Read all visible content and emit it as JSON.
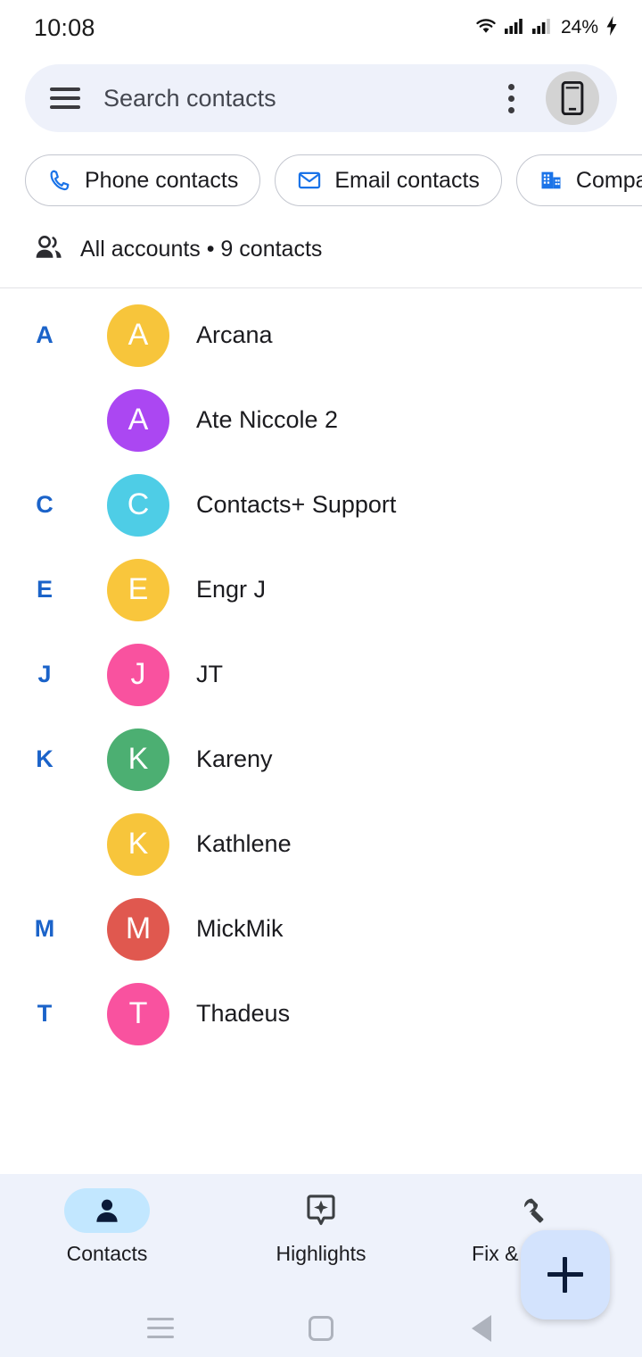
{
  "status_bar": {
    "time": "10:08",
    "battery_percent": "24%",
    "icons": [
      "wifi-icon",
      "signal-1-icon",
      "signal-2-icon",
      "charging-bolt-icon"
    ]
  },
  "search": {
    "menu_icon": "hamburger-menu-icon",
    "placeholder": "Search contacts",
    "value": "",
    "overflow_icon": "kebab-menu-icon",
    "account_icon": "device-phone-icon"
  },
  "filter_chips": [
    {
      "label": "Phone contacts",
      "icon": "phone-icon",
      "has_caret": false
    },
    {
      "label": "Email contacts",
      "icon": "envelope-icon",
      "has_caret": false
    },
    {
      "label": "Company",
      "icon": "building-icon",
      "has_caret": true
    }
  ],
  "account_summary": {
    "icon": "people-group-icon",
    "text": "All accounts • 9 contacts"
  },
  "contacts": [
    {
      "section": "A",
      "name": "Arcana",
      "initial": "A",
      "color": "#f9c game"
    },
    {
      "section": "",
      "name": "Ate Niccole 2",
      "initial": "A",
      "color": "#ab47f2"
    },
    {
      "section": "C",
      "name": "Contacts+ Support",
      "initial": "C",
      "color": "#4ecde6"
    },
    {
      "section": "E",
      "name": "Engr J",
      "initial": "E",
      "color": "#f9c63c"
    },
    {
      "section": "J",
      "name": "JT",
      "initial": "J",
      "color": "#f9529f"
    },
    {
      "section": "K",
      "name": "Kareny",
      "initial": "K",
      "color": "#4caf72"
    },
    {
      "section": "",
      "name": "Kathlene",
      "initial": "K",
      "color": "#f7c53b"
    },
    {
      "section": "M",
      "name": "MickMik",
      "initial": "M",
      "color": "#e0584f"
    },
    {
      "section": "T",
      "name": "Thadeus",
      "initial": "T",
      "color": "#f9529f"
    }
  ],
  "fab": {
    "icon": "plus-icon",
    "label": "Create contact"
  },
  "bottom_nav": [
    {
      "label": "Contacts",
      "icon": "person-icon",
      "active": true
    },
    {
      "label": "Highlights",
      "icon": "sparkle-card-icon",
      "active": false
    },
    {
      "label": "Fix & manage",
      "icon": "wrench-icon",
      "active": false
    }
  ],
  "system_nav": [
    {
      "name": "recent-apps-button"
    },
    {
      "name": "home-button"
    },
    {
      "name": "back-button"
    }
  ],
  "colors": {
    "accent_blue": "#1b63c9",
    "chip_icon_blue": "#1a73e8",
    "search_bg": "#eef1fa",
    "nav_bg": "#eef2fb",
    "fab_bg": "#d3e3fd",
    "active_pill": "#c2e7ff"
  }
}
